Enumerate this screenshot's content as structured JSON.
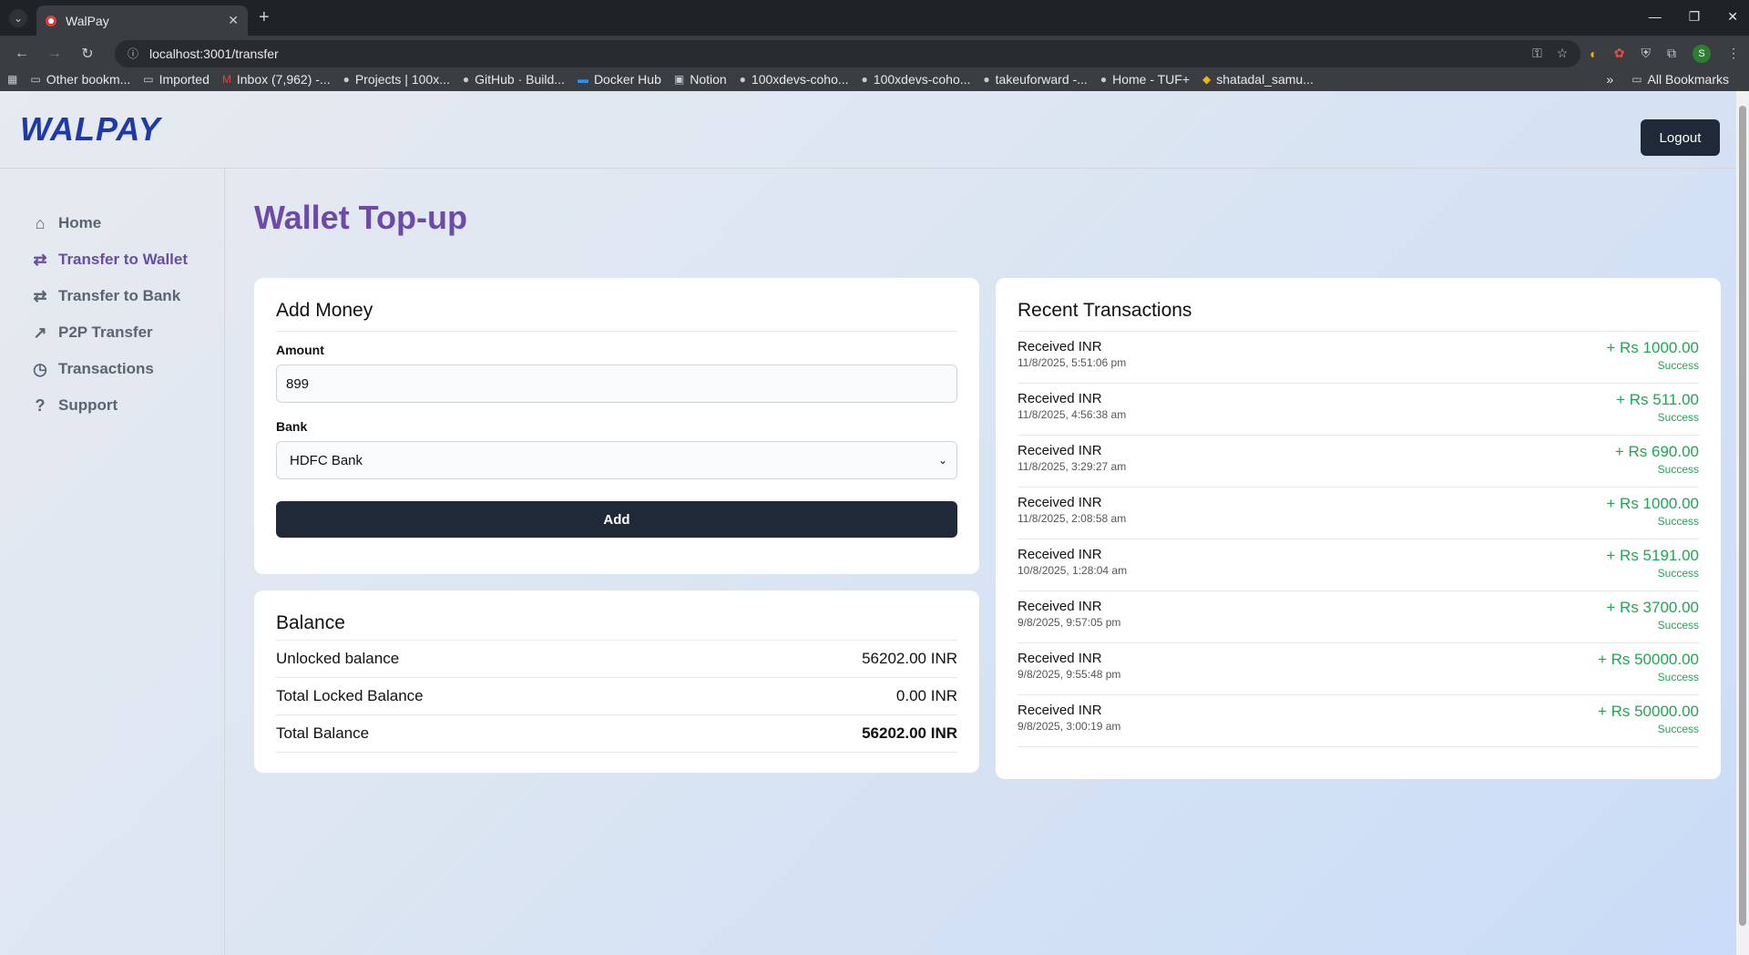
{
  "browser": {
    "tab_title": "WalPay",
    "url": "localhost:3001/transfer",
    "bookmarks": [
      "Other bookm...",
      "Imported",
      "Inbox (7,962) -...",
      "Projects | 100x...",
      "GitHub · Build...",
      "Docker Hub",
      "Notion",
      "100xdevs-coho...",
      "100xdevs-coho...",
      "takeuforward -...",
      "Home - TUF+",
      "shatadal_samu..."
    ],
    "all_bookmarks": "All Bookmarks",
    "profile_initial": "S"
  },
  "app": {
    "logo": "WALPAY",
    "logout": "Logout"
  },
  "sidebar": {
    "items": [
      {
        "label": "Home",
        "icon": "home-icon"
      },
      {
        "label": "Transfer to Wallet",
        "icon": "arrows-icon"
      },
      {
        "label": "Transfer to Bank",
        "icon": "arrows-icon"
      },
      {
        "label": "P2P Transfer",
        "icon": "trend-icon"
      },
      {
        "label": "Transactions",
        "icon": "clock-icon"
      },
      {
        "label": "Support",
        "icon": "help-icon"
      }
    ],
    "active": "Transfer to Wallet"
  },
  "main": {
    "title": "Wallet Top-up",
    "add_money": {
      "heading": "Add Money",
      "amount_label": "Amount",
      "amount_value": "899",
      "bank_label": "Bank",
      "bank_value": "HDFC Bank",
      "add_button": "Add"
    },
    "balance": {
      "heading": "Balance",
      "rows": [
        {
          "label": "Unlocked balance",
          "value": "56202.00 INR"
        },
        {
          "label": "Total Locked Balance",
          "value": "0.00 INR"
        },
        {
          "label": "Total Balance",
          "value": "56202.00 INR"
        }
      ]
    },
    "recent": {
      "heading": "Recent Transactions",
      "items": [
        {
          "title": "Received INR",
          "time": "11/8/2025, 5:51:06 pm",
          "amount": "+ Rs 1000.00",
          "status": "Success"
        },
        {
          "title": "Received INR",
          "time": "11/8/2025, 4:56:38 am",
          "amount": "+ Rs 511.00",
          "status": "Success"
        },
        {
          "title": "Received INR",
          "time": "11/8/2025, 3:29:27 am",
          "amount": "+ Rs 690.00",
          "status": "Success"
        },
        {
          "title": "Received INR",
          "time": "11/8/2025, 2:08:58 am",
          "amount": "+ Rs 1000.00",
          "status": "Success"
        },
        {
          "title": "Received INR",
          "time": "10/8/2025, 1:28:04 am",
          "amount": "+ Rs 5191.00",
          "status": "Success"
        },
        {
          "title": "Received INR",
          "time": "9/8/2025, 9:57:05 pm",
          "amount": "+ Rs 3700.00",
          "status": "Success"
        },
        {
          "title": "Received INR",
          "time": "9/8/2025, 9:55:48 pm",
          "amount": "+ Rs 50000.00",
          "status": "Success"
        },
        {
          "title": "Received INR",
          "time": "9/8/2025, 3:00:19 am",
          "amount": "+ Rs 50000.00",
          "status": "Success"
        }
      ]
    }
  },
  "colors": {
    "accent": "#6b4aa8",
    "logo": "#1f3aa8",
    "success": "#22a455",
    "dark_button": "#1f2937"
  }
}
